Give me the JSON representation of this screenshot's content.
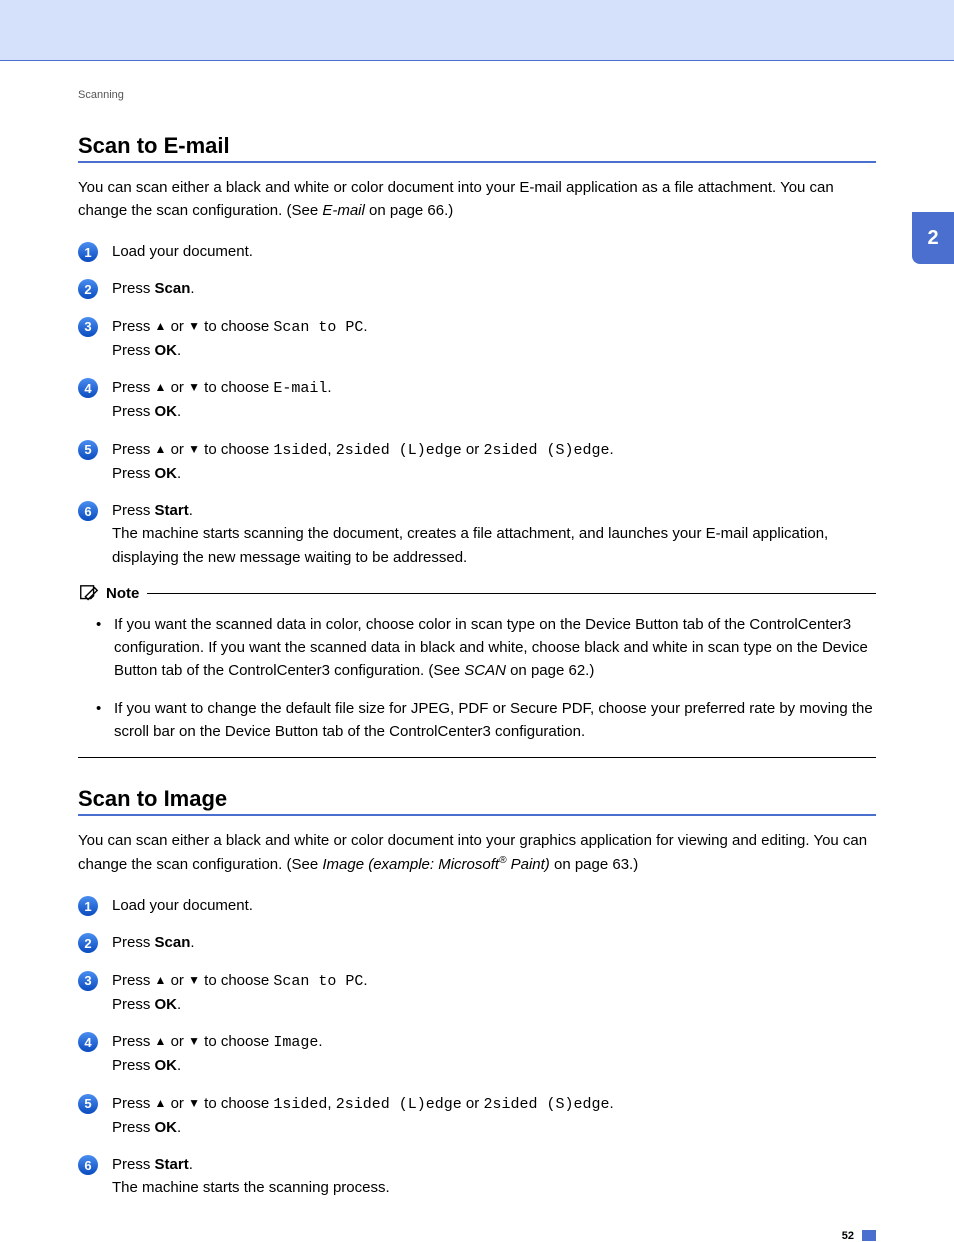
{
  "side_tab": "2",
  "page_number": "52",
  "breadcrumb": "Scanning",
  "section1": {
    "title": "Scan to E-mail",
    "intro_pre": "You can scan either a black and white or color document into your E-mail application as a file attachment. You can change the scan configuration. (See ",
    "intro_link": "E-mail",
    "intro_post": " on page 66.)",
    "steps": {
      "s1": "Load your document.",
      "s2_pre": "Press ",
      "s2_b": "Scan",
      "s2_post": ".",
      "s3": {
        "l1_a": "Press ",
        "l1_b": " or ",
        "l1_c": " to choose ",
        "l1_code": "Scan to PC",
        "l1_d": ".",
        "l2_a": "Press ",
        "l2_b": "OK",
        "l2_c": "."
      },
      "s4": {
        "l1_a": "Press ",
        "l1_b": " or ",
        "l1_c": " to choose ",
        "l1_code": "E-mail",
        "l1_d": ".",
        "l2_a": "Press ",
        "l2_b": "OK",
        "l2_c": "."
      },
      "s5": {
        "l1_a": "Press ",
        "l1_b": " or ",
        "l1_c": " to choose ",
        "l1_code1": "1sided",
        "l1_mid1": ", ",
        "l1_code2": "2sided (L)edge",
        "l1_mid2": " or ",
        "l1_code3": "2sided (S)edge",
        "l1_d": ".",
        "l2_a": "Press ",
        "l2_b": "OK",
        "l2_c": "."
      },
      "s6": {
        "l1_a": "Press ",
        "l1_b": "Start",
        "l1_c": ".",
        "l2": "The machine starts scanning the document, creates a file attachment, and launches your E-mail application, displaying the new message waiting to be addressed."
      }
    },
    "note_label": "Note",
    "notes": {
      "n1": {
        "a": "If you want the scanned data in color, choose color in scan type on the ",
        "b1": "Device Button",
        "c": " tab of the ControlCenter3 configuration. If you want the scanned data in black and white, choose black and white in scan type on the ",
        "b2": "Device Button",
        "d": " tab of the ControlCenter3 configuration. (See ",
        "link": "SCAN",
        "e": " on page 62.)"
      },
      "n2": {
        "a": "If you want to change the default file size for JPEG, PDF or Secure PDF, choose your preferred rate by moving the scroll bar on the ",
        "b1": "Device Button",
        "c": " tab of the ControlCenter3 configuration."
      }
    }
  },
  "section2": {
    "title": "Scan to Image",
    "intro_pre": "You can scan either a black and white or color document into your graphics application for viewing and editing. You can change the scan configuration. (See ",
    "intro_link_a": "Image (example: Microsoft",
    "intro_link_sup": "®",
    "intro_link_b": " Paint)",
    "intro_post": " on page 63.)",
    "steps": {
      "s1": "Load your document.",
      "s2_pre": "Press ",
      "s2_b": "Scan",
      "s2_post": ".",
      "s3": {
        "l1_a": "Press ",
        "l1_b": " or ",
        "l1_c": " to choose ",
        "l1_code": "Scan to PC",
        "l1_d": ".",
        "l2_a": "Press ",
        "l2_b": "OK",
        "l2_c": "."
      },
      "s4": {
        "l1_a": "Press ",
        "l1_b": " or ",
        "l1_c": " to choose ",
        "l1_code": "Image",
        "l1_d": ".",
        "l2_a": "Press ",
        "l2_b": "OK",
        "l2_c": "."
      },
      "s5": {
        "l1_a": "Press ",
        "l1_b": " or ",
        "l1_c": " to choose ",
        "l1_code1": "1sided",
        "l1_mid1": ", ",
        "l1_code2": "2sided (L)edge",
        "l1_mid2": " or ",
        "l1_code3": "2sided (S)edge",
        "l1_d": ".",
        "l2_a": "Press ",
        "l2_b": "OK",
        "l2_c": "."
      },
      "s6": {
        "l1_a": "Press ",
        "l1_b": "Start",
        "l1_c": ".",
        "l2": "The machine starts the scanning process."
      }
    }
  },
  "glyphs": {
    "up": "▲",
    "down": "▼"
  }
}
